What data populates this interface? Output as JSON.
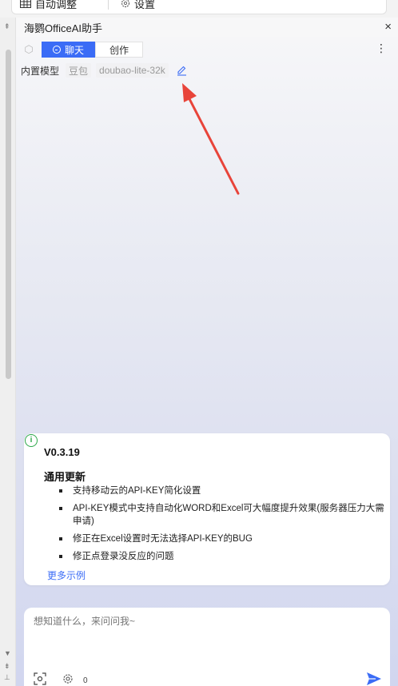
{
  "ribbon": {
    "auto_adjust_label": "自动调整",
    "settings_label": "设置"
  },
  "panel": {
    "title": "海鹦OfficeAI助手",
    "close_glyph": "×",
    "tabs": [
      {
        "label": "聊天",
        "active": true
      },
      {
        "label": "创作",
        "active": false
      }
    ],
    "menu_glyph": "⋮"
  },
  "model": {
    "label": "内置模型",
    "provider": "豆包",
    "name": "doubao-lite-32k"
  },
  "update": {
    "version": "V0.3.19",
    "section_title": "通用更新",
    "notes": [
      "支持移动云的API-KEY简化设置",
      "API-KEY模式中支持自动化WORD和Excel可大幅度提升效果(服务器压力大需申请)",
      "修正在Excel设置时无法选择API-KEY的BUG",
      "修正点登录没反应的问题"
    ],
    "more_link": "更多示例"
  },
  "input": {
    "placeholder": "想知道什么，来问问我~",
    "attachment_count": "0"
  },
  "colors": {
    "accent": "#3b6cf6",
    "info": "#2da84a",
    "annotation_arrow": "#e8443a"
  },
  "icons": [
    "table-icon",
    "gear-icon",
    "cube-icon",
    "chat-icon",
    "edit-icon",
    "info-icon",
    "scan-icon",
    "send-icon",
    "close-icon",
    "kebab-icon"
  ]
}
